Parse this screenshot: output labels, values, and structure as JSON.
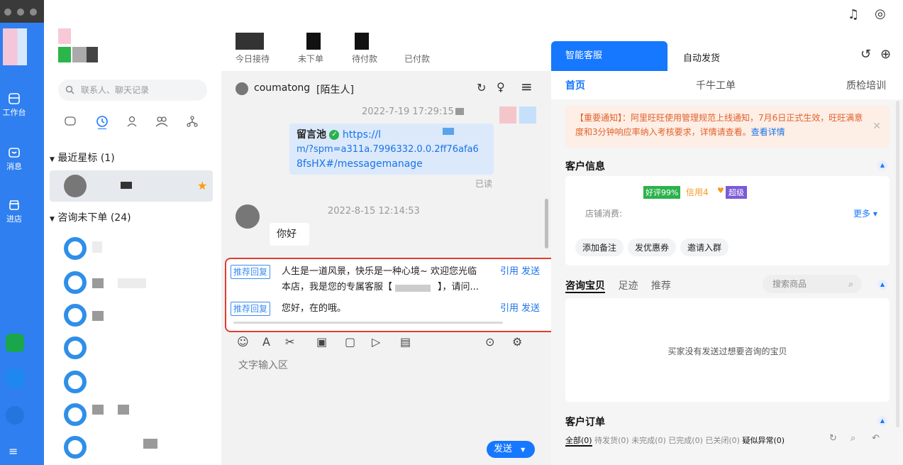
{
  "colors": {
    "accent": "#1677ff",
    "rail": "#2f7ff0",
    "warning": "#e2622b",
    "highlight": "#e03d31"
  },
  "rail": {
    "items": [
      {
        "label": "工作台",
        "icon": "workbench-icon"
      },
      {
        "label": "消息",
        "icon": "message-icon"
      },
      {
        "label": "进店",
        "icon": "store-icon"
      }
    ]
  },
  "contacts": {
    "search_placeholder": "联系人、聊天记录",
    "groups": [
      {
        "label": "最近星标 (1)"
      },
      {
        "label": "咨询未下单 (24)"
      }
    ]
  },
  "stats": [
    "今日接待",
    "未下单",
    "待付款",
    "已付款"
  ],
  "chat": {
    "contact_name": "coumatong",
    "contact_tag": "[陌生人]",
    "msg1_time": "2022-7-19 17:29:15",
    "msg1_name": "留言池",
    "msg1_link_line1": "https://l",
    "msg1_link_line2": "m/?spm=a311a.7996332.0.0.2ff76afa6",
    "msg1_link_line3": "8fsHX#/messagemanage",
    "msg1_status": "已读",
    "msg2_time": "2022-8-15 12:14:53",
    "msg2_text": "你好",
    "recommend": [
      {
        "tag": "推荐回复",
        "text_line1": "人生是一道风景，快乐是一种心境~ 欢迎您光临",
        "text_line2": "本店，我是您的专属客服【",
        "text_tail": "】，请问...",
        "quote": "引用",
        "send": "发送"
      },
      {
        "tag": "推荐回复",
        "text_line1": "您好，在的哦。",
        "quote": "引用",
        "send": "发送"
      }
    ],
    "input_placeholder": "文字输入区",
    "send_button": "发送"
  },
  "right": {
    "tabs": [
      "智能客服",
      "自动发货"
    ],
    "subtabs": [
      "首页",
      "千牛工单",
      "质检培训"
    ],
    "notice": "【重要通知】：阿里旺旺使用管理规范上线通知，7月6日正式生效，旺旺满意度和3分钟响应率纳入考核要求，详情请查看。",
    "notice_link": "查看详情",
    "customer_title": "客户信息",
    "badge_rating": "好评99%",
    "badge_credit": "信用4",
    "badge_level": "超级",
    "shop_spend": "店铺消费:",
    "more": "更多",
    "actions": [
      "添加备注",
      "发优惠券",
      "邀请入群"
    ],
    "product_tabs": [
      "咨询宝贝",
      "足迹",
      "推荐"
    ],
    "product_search": "搜索商品",
    "empty_products": "买家没有发送过想要咨询的宝贝",
    "orders_title": "客户订单",
    "order_filters": [
      "全部(0)",
      "待发货(0)",
      "未完成(0)",
      "已完成(0)",
      "已关闭(0)",
      "疑似异常(0)"
    ]
  }
}
